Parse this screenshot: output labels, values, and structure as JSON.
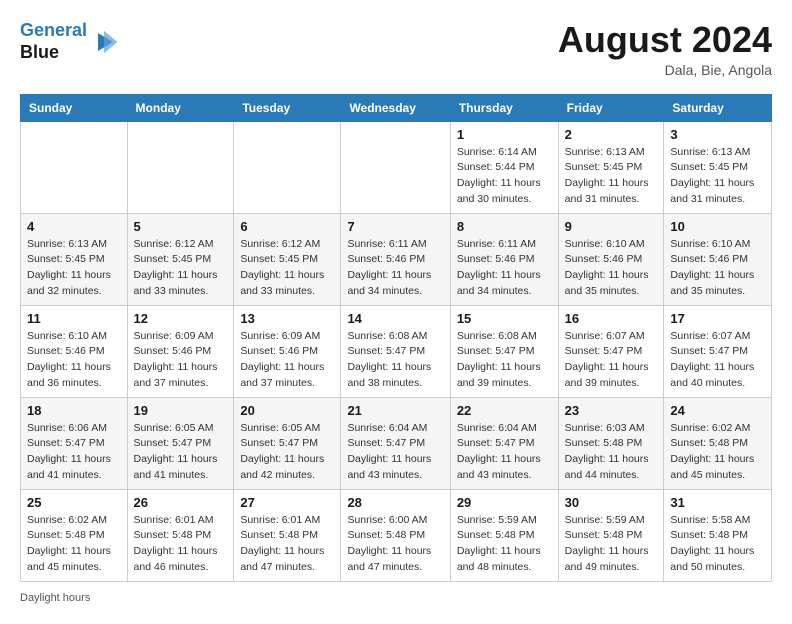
{
  "header": {
    "logo_line1": "General",
    "logo_line2": "Blue",
    "month": "August 2024",
    "location": "Dala, Bie, Angola"
  },
  "days_of_week": [
    "Sunday",
    "Monday",
    "Tuesday",
    "Wednesday",
    "Thursday",
    "Friday",
    "Saturday"
  ],
  "weeks": [
    [
      {
        "day": "",
        "info": ""
      },
      {
        "day": "",
        "info": ""
      },
      {
        "day": "",
        "info": ""
      },
      {
        "day": "",
        "info": ""
      },
      {
        "day": "1",
        "info": "Sunrise: 6:14 AM\nSunset: 5:44 PM\nDaylight: 11 hours and 30 minutes."
      },
      {
        "day": "2",
        "info": "Sunrise: 6:13 AM\nSunset: 5:45 PM\nDaylight: 11 hours and 31 minutes."
      },
      {
        "day": "3",
        "info": "Sunrise: 6:13 AM\nSunset: 5:45 PM\nDaylight: 11 hours and 31 minutes."
      }
    ],
    [
      {
        "day": "4",
        "info": "Sunrise: 6:13 AM\nSunset: 5:45 PM\nDaylight: 11 hours and 32 minutes."
      },
      {
        "day": "5",
        "info": "Sunrise: 6:12 AM\nSunset: 5:45 PM\nDaylight: 11 hours and 33 minutes."
      },
      {
        "day": "6",
        "info": "Sunrise: 6:12 AM\nSunset: 5:45 PM\nDaylight: 11 hours and 33 minutes."
      },
      {
        "day": "7",
        "info": "Sunrise: 6:11 AM\nSunset: 5:46 PM\nDaylight: 11 hours and 34 minutes."
      },
      {
        "day": "8",
        "info": "Sunrise: 6:11 AM\nSunset: 5:46 PM\nDaylight: 11 hours and 34 minutes."
      },
      {
        "day": "9",
        "info": "Sunrise: 6:10 AM\nSunset: 5:46 PM\nDaylight: 11 hours and 35 minutes."
      },
      {
        "day": "10",
        "info": "Sunrise: 6:10 AM\nSunset: 5:46 PM\nDaylight: 11 hours and 35 minutes."
      }
    ],
    [
      {
        "day": "11",
        "info": "Sunrise: 6:10 AM\nSunset: 5:46 PM\nDaylight: 11 hours and 36 minutes."
      },
      {
        "day": "12",
        "info": "Sunrise: 6:09 AM\nSunset: 5:46 PM\nDaylight: 11 hours and 37 minutes."
      },
      {
        "day": "13",
        "info": "Sunrise: 6:09 AM\nSunset: 5:46 PM\nDaylight: 11 hours and 37 minutes."
      },
      {
        "day": "14",
        "info": "Sunrise: 6:08 AM\nSunset: 5:47 PM\nDaylight: 11 hours and 38 minutes."
      },
      {
        "day": "15",
        "info": "Sunrise: 6:08 AM\nSunset: 5:47 PM\nDaylight: 11 hours and 39 minutes."
      },
      {
        "day": "16",
        "info": "Sunrise: 6:07 AM\nSunset: 5:47 PM\nDaylight: 11 hours and 39 minutes."
      },
      {
        "day": "17",
        "info": "Sunrise: 6:07 AM\nSunset: 5:47 PM\nDaylight: 11 hours and 40 minutes."
      }
    ],
    [
      {
        "day": "18",
        "info": "Sunrise: 6:06 AM\nSunset: 5:47 PM\nDaylight: 11 hours and 41 minutes."
      },
      {
        "day": "19",
        "info": "Sunrise: 6:05 AM\nSunset: 5:47 PM\nDaylight: 11 hours and 41 minutes."
      },
      {
        "day": "20",
        "info": "Sunrise: 6:05 AM\nSunset: 5:47 PM\nDaylight: 11 hours and 42 minutes."
      },
      {
        "day": "21",
        "info": "Sunrise: 6:04 AM\nSunset: 5:47 PM\nDaylight: 11 hours and 43 minutes."
      },
      {
        "day": "22",
        "info": "Sunrise: 6:04 AM\nSunset: 5:47 PM\nDaylight: 11 hours and 43 minutes."
      },
      {
        "day": "23",
        "info": "Sunrise: 6:03 AM\nSunset: 5:48 PM\nDaylight: 11 hours and 44 minutes."
      },
      {
        "day": "24",
        "info": "Sunrise: 6:02 AM\nSunset: 5:48 PM\nDaylight: 11 hours and 45 minutes."
      }
    ],
    [
      {
        "day": "25",
        "info": "Sunrise: 6:02 AM\nSunset: 5:48 PM\nDaylight: 11 hours and 45 minutes."
      },
      {
        "day": "26",
        "info": "Sunrise: 6:01 AM\nSunset: 5:48 PM\nDaylight: 11 hours and 46 minutes."
      },
      {
        "day": "27",
        "info": "Sunrise: 6:01 AM\nSunset: 5:48 PM\nDaylight: 11 hours and 47 minutes."
      },
      {
        "day": "28",
        "info": "Sunrise: 6:00 AM\nSunset: 5:48 PM\nDaylight: 11 hours and 47 minutes."
      },
      {
        "day": "29",
        "info": "Sunrise: 5:59 AM\nSunset: 5:48 PM\nDaylight: 11 hours and 48 minutes."
      },
      {
        "day": "30",
        "info": "Sunrise: 5:59 AM\nSunset: 5:48 PM\nDaylight: 11 hours and 49 minutes."
      },
      {
        "day": "31",
        "info": "Sunrise: 5:58 AM\nSunset: 5:48 PM\nDaylight: 11 hours and 50 minutes."
      }
    ]
  ],
  "footer": {
    "label": "Daylight hours"
  }
}
